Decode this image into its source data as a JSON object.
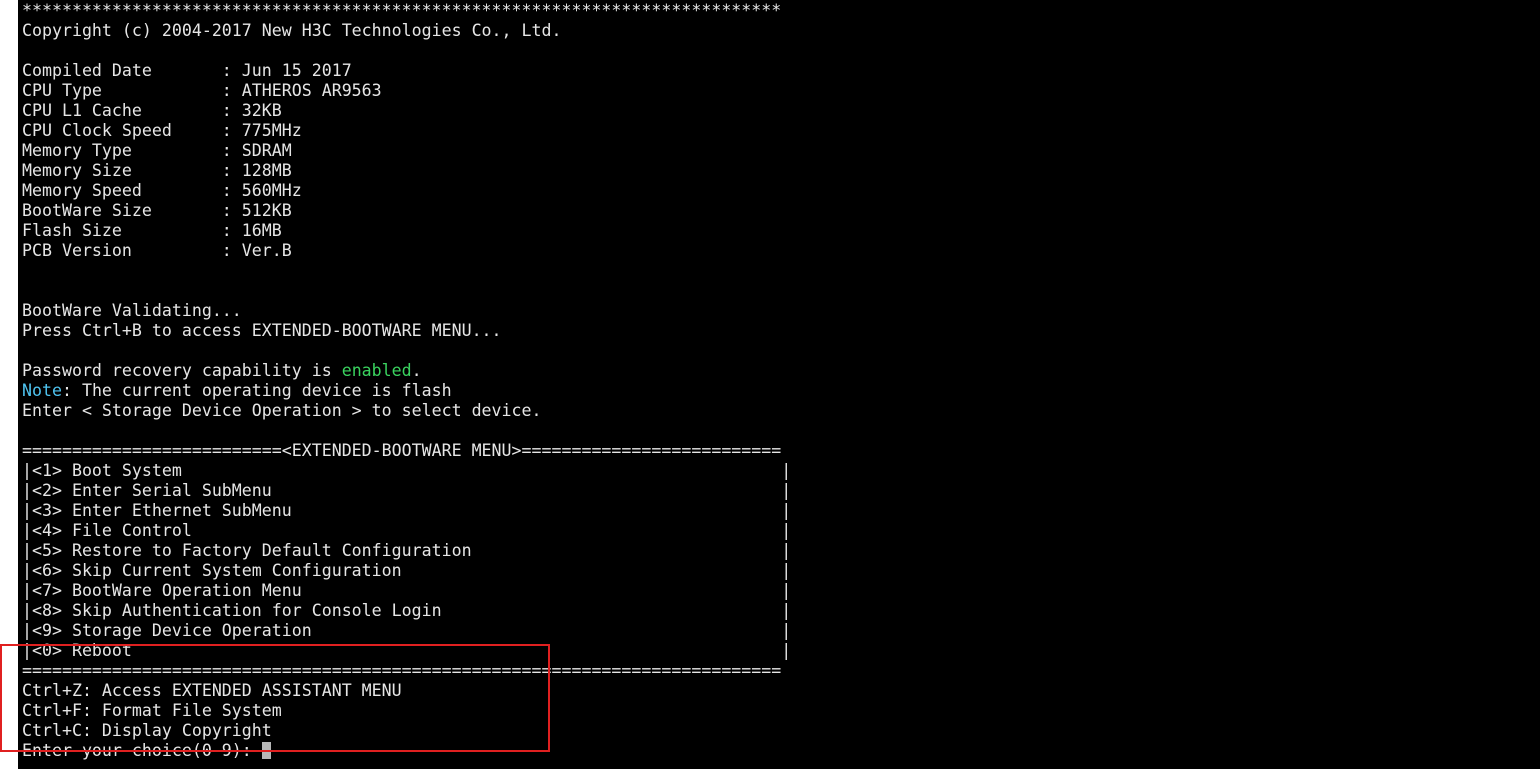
{
  "terminal": {
    "lines": [
      {
        "text": "****************************************************************************"
      },
      {
        "text": "Copyright (c) 2004-2017 New H3C Technologies Co., Ltd."
      },
      {
        "text": ""
      },
      {
        "text": "Compiled Date       : Jun 15 2017"
      },
      {
        "text": "CPU Type            : ATHEROS AR9563"
      },
      {
        "text": "CPU L1 Cache        : 32KB"
      },
      {
        "text": "CPU Clock Speed     : 775MHz"
      },
      {
        "text": "Memory Type         : SDRAM"
      },
      {
        "text": "Memory Size         : 128MB"
      },
      {
        "text": "Memory Speed        : 560MHz"
      },
      {
        "text": "BootWare Size       : 512KB"
      },
      {
        "text": "Flash Size          : 16MB"
      },
      {
        "text": "PCB Version         : Ver.B"
      },
      {
        "text": ""
      },
      {
        "text": ""
      },
      {
        "text": "BootWare Validating..."
      },
      {
        "text": "Press Ctrl+B to access EXTENDED-BOOTWARE MENU..."
      },
      {
        "text": ""
      },
      {
        "text": "Password recovery capability is ",
        "highlight": "enabled",
        "suffix": "."
      },
      {
        "prefix": "Note",
        "text": ": The current operating device is flash"
      },
      {
        "text": "Enter < Storage Device Operation > to select device."
      },
      {
        "text": ""
      },
      {
        "text": "==========================<EXTENDED-BOOTWARE MENU>=========================="
      },
      {
        "text": "|<1> Boot System                                                            |"
      },
      {
        "text": "|<2> Enter Serial SubMenu                                                   |"
      },
      {
        "text": "|<3> Enter Ethernet SubMenu                                                 |"
      },
      {
        "text": "|<4> File Control                                                           |"
      },
      {
        "text": "|<5> Restore to Factory Default Configuration                               |"
      },
      {
        "text": "|<6> Skip Current System Configuration                                      |"
      },
      {
        "text": "|<7> BootWare Operation Menu                                                |"
      },
      {
        "text": "|<8> Skip Authentication for Console Login                                  |"
      },
      {
        "text": "|<9> Storage Device Operation                                               |"
      },
      {
        "text": "|<0> Reboot                                                                 |"
      },
      {
        "text": "============================================================================"
      },
      {
        "text": "Ctrl+Z: Access EXTENDED ASSISTANT MENU"
      },
      {
        "text": "Ctrl+F: Format File System"
      },
      {
        "text": "Ctrl+C: Display Copyright"
      },
      {
        "text": "Enter your choice(0-9): ",
        "cursor": true
      }
    ]
  },
  "colors": {
    "background": "#000000",
    "foreground": "#e6e6e6",
    "enabled_text": "#3ad35f",
    "note_text": "#4fc3ef",
    "annotation_box": "#e02020"
  }
}
